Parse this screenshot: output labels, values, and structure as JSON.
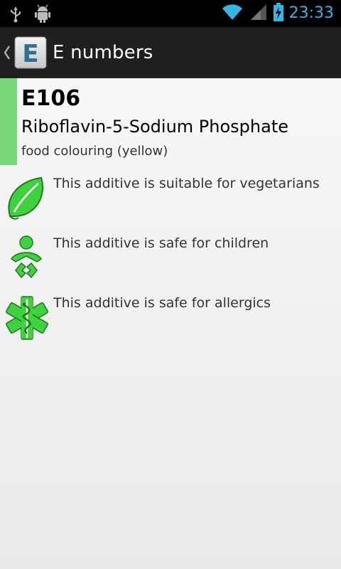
{
  "status_bar": {
    "time": "23:33",
    "icons": [
      "usb-icon",
      "android-debug-icon",
      "wifi-icon",
      "signal-icon",
      "battery-charging-icon"
    ]
  },
  "action_bar": {
    "title": "E numbers",
    "app_icon_letter": "E"
  },
  "additive": {
    "code": "E106",
    "name": "Riboflavin-5-Sodium Phosphate",
    "category": "food colouring (yellow)",
    "accent_color": "#78d878"
  },
  "features": [
    {
      "icon": "leaf-icon",
      "text": "This additive is suitable for vegetarians"
    },
    {
      "icon": "child-icon",
      "text": "This additive is safe for children"
    },
    {
      "icon": "medical-star-icon",
      "text": "This additive is safe for allergics"
    }
  ],
  "colors": {
    "icon_green": "#3fd23f",
    "status_blue": "#33b5e5"
  }
}
